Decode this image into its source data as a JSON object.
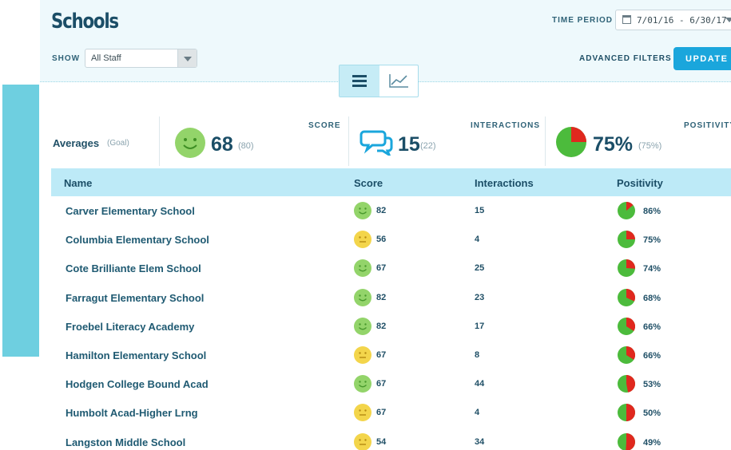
{
  "header": {
    "title": "Schools",
    "time_period_label": "TIME PERIOD",
    "date_range": "7/01/16 - 6/30/17",
    "show_label": "SHOW",
    "show_value": "All Staff",
    "advanced_filters": "ADVANCED FILTERS",
    "update_label": "UPDATE"
  },
  "view_toggle": {
    "active": "list"
  },
  "averages": {
    "label": "Averages",
    "goal_label": "(Goal)",
    "score": {
      "title": "SCORE",
      "value": "68",
      "goal": "(80)",
      "face": "happy"
    },
    "interactions": {
      "title": "INTERACTIONS",
      "value": "15",
      "goal": "(22)"
    },
    "positivity": {
      "title": "POSITIVITY",
      "value": "75%",
      "goal": "(75%)",
      "fraction": 0.75
    }
  },
  "table": {
    "columns": [
      "Name",
      "Score",
      "Interactions",
      "Positivity"
    ],
    "rows": [
      {
        "name": "Carver Elementary School",
        "score": "82",
        "face": "happy",
        "interactions": "15",
        "positivity": "86%",
        "pos_fraction": 0.86
      },
      {
        "name": "Columbia Elementary School",
        "score": "56",
        "face": "neutral",
        "interactions": "4",
        "positivity": "75%",
        "pos_fraction": 0.75
      },
      {
        "name": "Cote Brilliante Elem School",
        "score": "67",
        "face": "happy",
        "interactions": "25",
        "positivity": "74%",
        "pos_fraction": 0.74
      },
      {
        "name": "Farragut Elementary School",
        "score": "82",
        "face": "happy",
        "interactions": "23",
        "positivity": "68%",
        "pos_fraction": 0.68
      },
      {
        "name": "Froebel Literacy Academy",
        "score": "82",
        "face": "happy",
        "interactions": "17",
        "positivity": "66%",
        "pos_fraction": 0.66
      },
      {
        "name": "Hamilton Elementary School",
        "score": "67",
        "face": "neutral",
        "interactions": "8",
        "positivity": "66%",
        "pos_fraction": 0.66
      },
      {
        "name": "Hodgen College Bound Acad",
        "score": "67",
        "face": "happy",
        "interactions": "44",
        "positivity": "53%",
        "pos_fraction": 0.53
      },
      {
        "name": "Humbolt Acad-Higher Lrng",
        "score": "67",
        "face": "neutral",
        "interactions": "4",
        "positivity": "50%",
        "pos_fraction": 0.5
      },
      {
        "name": "Langston Middle School",
        "score": "54",
        "face": "neutral",
        "interactions": "34",
        "positivity": "49%",
        "pos_fraction": 0.49
      }
    ]
  },
  "colors": {
    "accent": "#1aa6dc",
    "header_bg": "#eef9fc",
    "table_head": "#bdeaf7",
    "happy_face": "#93d46a",
    "neutral_face": "#f3d54b",
    "pie_green": "#4cbb3c",
    "pie_red": "#e0281e"
  }
}
